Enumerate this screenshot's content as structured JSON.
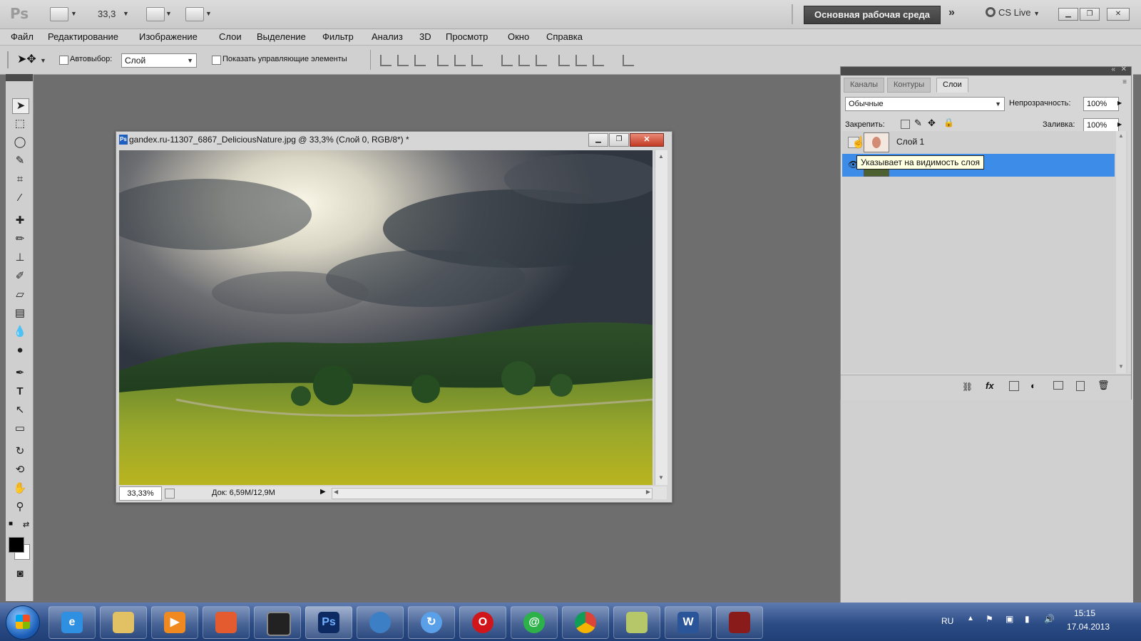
{
  "appbar": {
    "logo": "Ps",
    "zoom_value": "33,3",
    "workspace_label": "Основная рабочая среда",
    "cs_live_label": "CS Live"
  },
  "menu": [
    "Файл",
    "Редактирование",
    "Изображение",
    "Слои",
    "Выделение",
    "Фильтр",
    "Анализ",
    "3D",
    "Просмотр",
    "Окно",
    "Справка"
  ],
  "options": {
    "autoselect_label": "Автовыбор:",
    "autoselect_value": "Слой",
    "show_controls_label": "Показать управляющие элементы"
  },
  "document": {
    "title": "gandex.ru-11307_6867_DeliciousNature.jpg @ 33,3% (Слой 0, RGB/8*) *",
    "zoom": "33,33%",
    "doc_size": "Док: 6,59M/12,9M"
  },
  "panel": {
    "tabs": [
      "Каналы",
      "Контуры",
      "Слои"
    ],
    "active_tab": "Слои",
    "blend_mode": "Обычные",
    "opacity_label": "Непрозрачность:",
    "opacity_value": "100%",
    "lock_label": "Закрепить:",
    "fill_label": "Заливка:",
    "fill_value": "100%",
    "layers": [
      {
        "name": "Слой 1",
        "selected": false
      },
      {
        "name": "",
        "selected": true
      }
    ],
    "tooltip": "Указывает на видимость слоя",
    "bottom_fx": "fx"
  },
  "tray": {
    "lang": "RU",
    "time": "15:15",
    "date": "17.04.2013"
  },
  "colors": {
    "selection_blue": "#3c8ce8",
    "taskbar_blue": "#2c4c86"
  }
}
